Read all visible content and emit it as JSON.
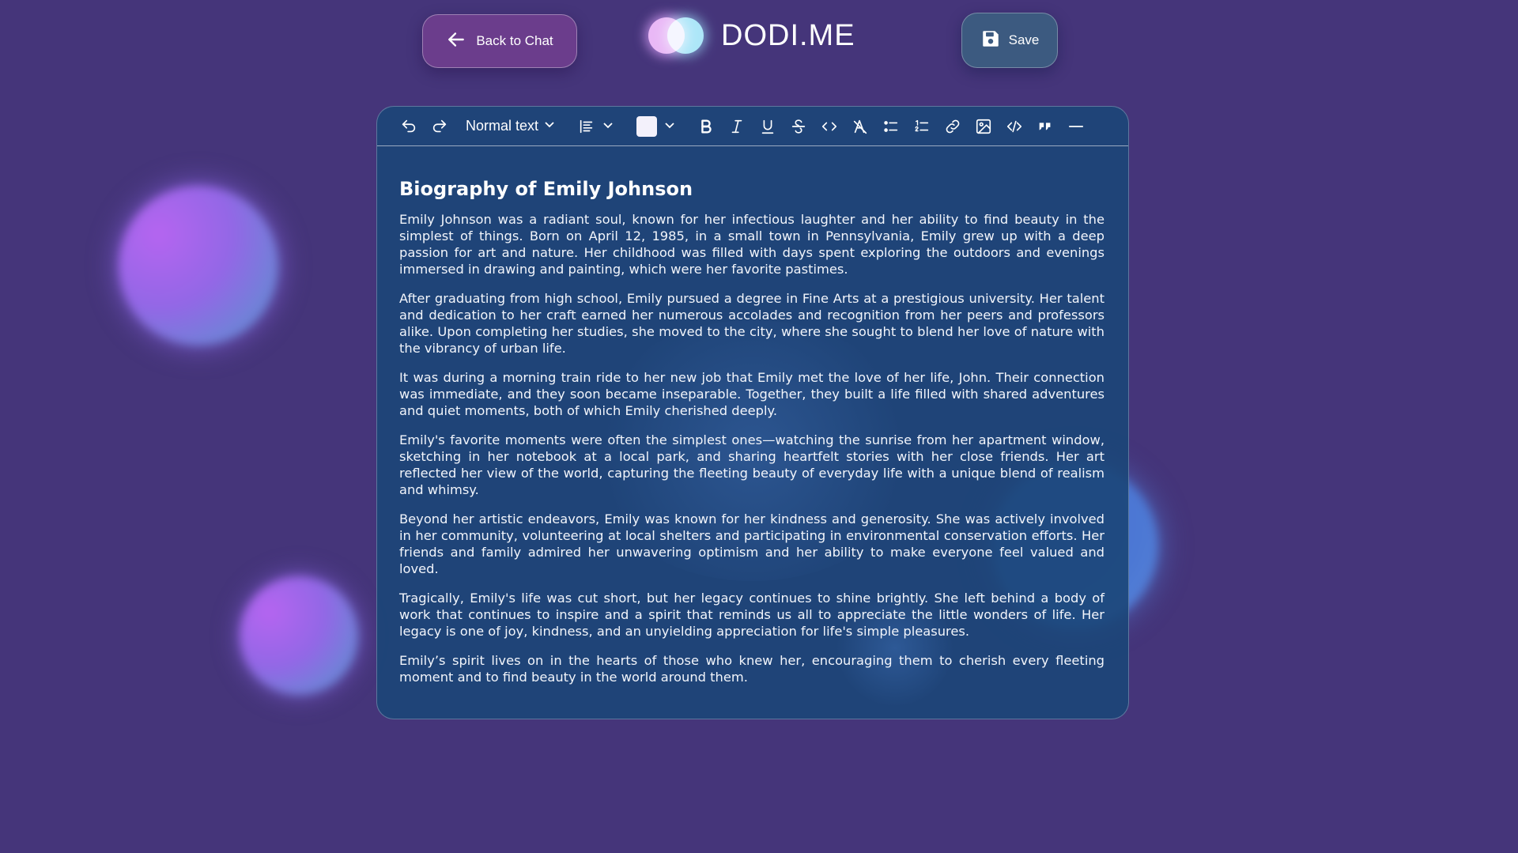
{
  "header": {
    "back_label": "Back to Chat",
    "brand_name": "DODI.ME",
    "save_label": "Save"
  },
  "toolbar": {
    "text_style": "Normal text",
    "text_color": "#f3f1fb",
    "icons": [
      "undo-icon",
      "redo-icon",
      "align-left-icon",
      "bold-icon",
      "italic-icon",
      "underline-icon",
      "strikethrough-icon",
      "inline-code-icon",
      "clear-format-icon",
      "bullet-list-icon",
      "numbered-list-icon",
      "link-icon",
      "image-icon",
      "code-block-icon",
      "quote-icon",
      "horizontal-rule-icon"
    ]
  },
  "document": {
    "title": "Biography of Emily Johnson",
    "paragraphs": [
      "Emily Johnson was a radiant soul, known for her infectious laughter and her ability to find beauty in the simplest of things. Born on April 12, 1985, in a small town in Pennsylvania, Emily grew up with a deep passion for art and nature. Her childhood was filled with days spent exploring the outdoors and evenings immersed in drawing and painting, which were her favorite pastimes.",
      "After graduating from high school, Emily pursued a degree in Fine Arts at a prestigious university. Her talent and dedication to her craft earned her numerous accolades and recognition from her peers and professors alike. Upon completing her studies, she moved to the city, where she sought to blend her love of nature with the vibrancy of urban life.",
      "It was during a morning train ride to her new job that Emily met the love of her life, John. Their connection was immediate, and they soon became inseparable. Together, they built a life filled with shared adventures and quiet moments, both of which Emily cherished deeply.",
      "Emily's favorite moments were often the simplest ones—watching the sunrise from her apartment window, sketching in her notebook at a local park, and sharing heartfelt stories with her close friends. Her art reflected her view of the world, capturing the fleeting beauty of everyday life with a unique blend of realism and whimsy.",
      "Beyond her artistic endeavors, Emily was known for her kindness and generosity. She was actively involved in her community, volunteering at local shelters and participating in environmental conservation efforts. Her friends and family admired her unwavering optimism and her ability to make everyone feel valued and loved.",
      "Tragically, Emily's life was cut short, but her legacy continues to shine brightly. She left behind a body of work that continues to inspire and a spirit that reminds us all to appreciate the little wonders of life. Her legacy is one of joy, kindness, and an unyielding appreciation for life's simple pleasures.",
      "Emily’s spirit lives on in the hearts of those who knew her, encouraging them to cherish every fleeting moment and to find beauty in the world around them."
    ]
  },
  "colors": {
    "background": "#45357a",
    "editor_bg": "#1b4678",
    "back_button_bg": "#6b3d8c",
    "save_button_bg": "#3c5a80"
  }
}
